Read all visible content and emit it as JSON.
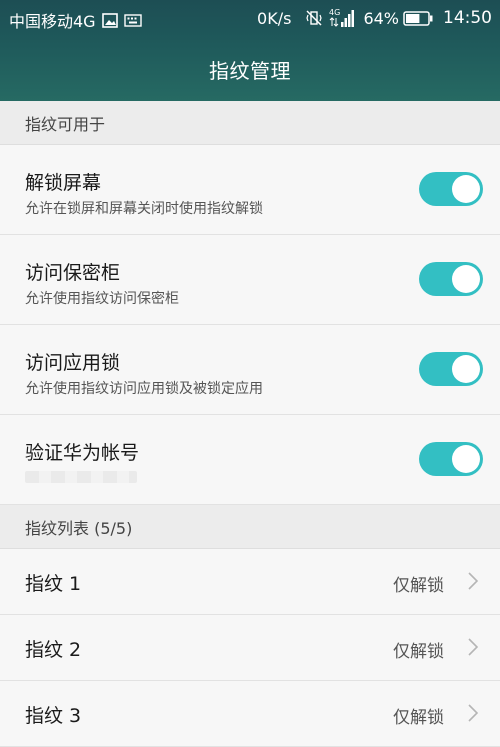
{
  "status_bar": {
    "carrier": "中国移动4G",
    "net_speed": "0K/s",
    "network_tag": "4G",
    "battery_percent": "64%",
    "battery_level": 0.64,
    "time": "14:50"
  },
  "header": {
    "title": "指纹管理"
  },
  "usage_section": {
    "header": "指纹可用于",
    "items": [
      {
        "title": "解锁屏幕",
        "subtitle": "允许在锁屏和屏幕关闭时使用指纹解锁",
        "enabled": true
      },
      {
        "title": "访问保密柜",
        "subtitle": "允许使用指纹访问保密柜",
        "enabled": true
      },
      {
        "title": "访问应用锁",
        "subtitle": "允许使用指纹访问应用锁及被锁定应用",
        "enabled": true
      },
      {
        "title": "验证华为帐号",
        "subtitle": "",
        "enabled": true
      }
    ]
  },
  "fingerprint_section": {
    "header": "指纹列表 (5/5)",
    "items": [
      {
        "name": "指纹 1",
        "value": "仅解锁"
      },
      {
        "name": "指纹 2",
        "value": "仅解锁"
      },
      {
        "name": "指纹 3",
        "value": "仅解锁"
      }
    ]
  },
  "colors": {
    "header_gradient_top": "#1d4e54",
    "header_gradient_bottom": "#266a63",
    "switch_on": "#33bfc3"
  },
  "icons": [
    "image-icon",
    "keyboard-icon",
    "vibrate-icon",
    "signal-icon",
    "battery-icon",
    "chevron-right-icon"
  ]
}
